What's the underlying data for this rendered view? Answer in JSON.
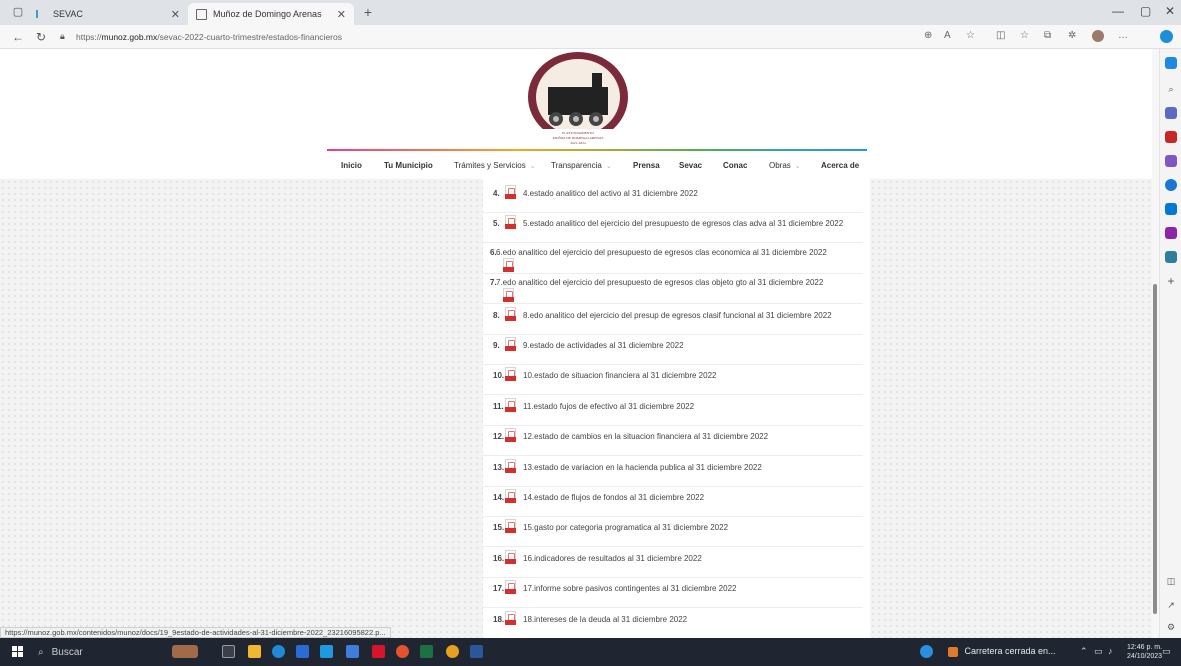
{
  "browser": {
    "tabs": [
      {
        "label": "SEVAC",
        "active": false
      },
      {
        "label": "Muñoz de Domingo Arenas",
        "active": true
      }
    ],
    "new_tab_symbol": "+",
    "url_prefix": "https://",
    "url_host": "munoz.gob.mx",
    "url_path": "/sevac-2022-cuarto-trimestre/estados-financieros",
    "status_url": "https://munoz.gob.mx/contenidos/munoz/docs/19_9estado-de-actividades-al-31-diciembre-2022_23216095822.p..."
  },
  "logo": {
    "line1": "H. AYUNTAMIENTO",
    "line2": "MUÑOZ DE DOMINGO ARENAS",
    "line3": "2021-2024",
    "brand_color": "#7a2a3a"
  },
  "nav": {
    "items": [
      {
        "label": "Inicio",
        "bold": true,
        "dropdown": false
      },
      {
        "label": "Tu Municipio",
        "bold": true,
        "dropdown": false
      },
      {
        "label": "Trámites y Servicios",
        "bold": false,
        "dropdown": true
      },
      {
        "label": "Transparencia",
        "bold": false,
        "dropdown": true
      },
      {
        "label": "Prensa",
        "bold": true,
        "dropdown": false
      },
      {
        "label": "Sevac",
        "bold": true,
        "dropdown": false
      },
      {
        "label": "Conac",
        "bold": true,
        "dropdown": false
      },
      {
        "label": "Obras",
        "bold": false,
        "dropdown": true
      },
      {
        "label": "Acerca de",
        "bold": true,
        "dropdown": false
      }
    ]
  },
  "documents": [
    {
      "num": "4.",
      "title": "4.estado analitico del activo al 31 diciembre 2022",
      "icon_below": false
    },
    {
      "num": "5.",
      "title": "5.estado analitico del ejercicio del presupuesto de egresos clas adva al 31 diciembre 2022",
      "icon_below": false
    },
    {
      "num": "6.",
      "title": "6.edo analitico del ejercicio del presupuesto de egresos clas economica al 31 diciembre 2022",
      "icon_below": true
    },
    {
      "num": "7.",
      "title": "7.edo analitico del ejercicio del presupuesto de egresos clas objeto gto al 31 diciembre 2022",
      "icon_below": true
    },
    {
      "num": "8.",
      "title": "8.edo analitico del ejercicio del presup de egresos clasif funcional al 31 diciembre 2022",
      "icon_below": false
    },
    {
      "num": "9.",
      "title": "9.estado de actividades al 31 diciembre 2022",
      "icon_below": false
    },
    {
      "num": "10.",
      "title": "10.estado de situacion financiera al 31 diciembre 2022",
      "icon_below": false
    },
    {
      "num": "11.",
      "title": "11.estado fujos de efectivo al 31 diciembre 2022",
      "icon_below": false
    },
    {
      "num": "12.",
      "title": "12.estado de cambios en la situacion financiera al 31 diciembre 2022",
      "icon_below": false
    },
    {
      "num": "13.",
      "title": "13.estado de variacion en la hacienda publica al 31 diciembre 2022",
      "icon_below": false
    },
    {
      "num": "14.",
      "title": "14.estado de flujos de fondos al 31 diciembre 2022",
      "icon_below": false
    },
    {
      "num": "15.",
      "title": "15.gasto por categoria programatica al 31 diciembre 2022",
      "icon_below": false
    },
    {
      "num": "16.",
      "title": "16.indicadores de resultados al 31 diciembre 2022",
      "icon_below": false
    },
    {
      "num": "17.",
      "title": "17.informe sobre pasivos contingentes al 31 diciembre 2022",
      "icon_below": false
    },
    {
      "num": "18.",
      "title": "18.intereses de la deuda al 31 diciembre 2022",
      "icon_below": false
    }
  ],
  "taskbar": {
    "search_label": "Buscar",
    "weather_text": "Carretera cerrada en...",
    "time": "12:46 p. m.",
    "date": "24/10/2023"
  }
}
